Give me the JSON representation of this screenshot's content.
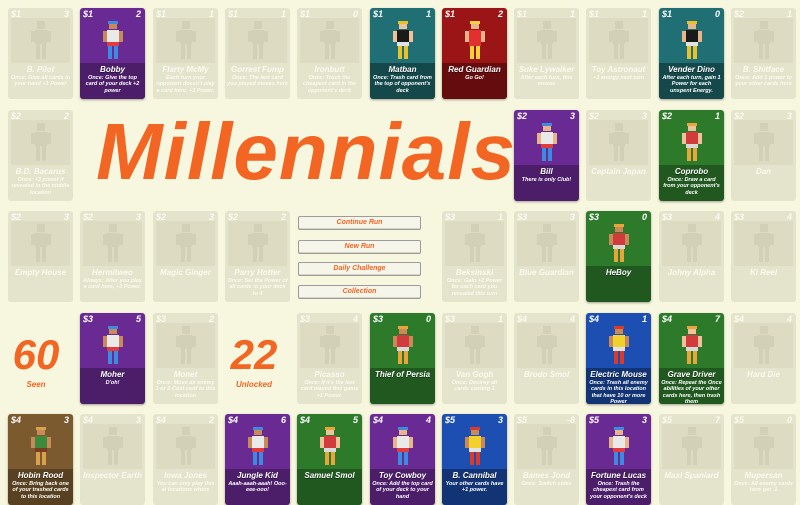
{
  "title": "Millennials",
  "menu": {
    "continue_run": "Continue Run",
    "new_run": "New Run",
    "daily_challenge": "Daily Challenge",
    "collection": "Collection"
  },
  "stats": {
    "seen_value": "60",
    "seen_label": "Seen",
    "unlocked_value": "22",
    "unlocked_label": "Unlocked"
  },
  "cards": [
    {
      "col": 0,
      "row": 0,
      "cost": "$1",
      "power": "3",
      "name": "B. Pilot",
      "desc": "Once: Give all cards in your hand +1 Power",
      "unlocked": false
    },
    {
      "col": 1,
      "row": 0,
      "cost": "$1",
      "power": "2",
      "name": "Bobby",
      "desc": "Once: Give the top card of your deck +2 power",
      "unlocked": true,
      "color": "purple"
    },
    {
      "col": 2,
      "row": 0,
      "cost": "$1",
      "power": "1",
      "name": "Flarty McMy",
      "desc": "Each turn your opponent doesn't play a card here, +3 Power.",
      "unlocked": false
    },
    {
      "col": 3,
      "row": 0,
      "cost": "$1",
      "power": "1",
      "name": "Gorrest Fump",
      "desc": "Once: The last card you played moves here",
      "unlocked": false
    },
    {
      "col": 4,
      "row": 0,
      "cost": "$1",
      "power": "0",
      "name": "Ironbutt",
      "desc": "Once: Trash the cheapest card in the opponent's deck",
      "unlocked": false
    },
    {
      "col": 5,
      "row": 0,
      "cost": "$1",
      "power": "1",
      "name": "Matban",
      "desc": "Once: Trash card from the top of opponent's deck",
      "unlocked": true,
      "color": "teal"
    },
    {
      "col": 6,
      "row": 0,
      "cost": "$1",
      "power": "2",
      "name": "Red Guardian",
      "desc": "Go Go!",
      "unlocked": true,
      "color": "red"
    },
    {
      "col": 7,
      "row": 0,
      "cost": "$1",
      "power": "1",
      "name": "Suke Lywalker",
      "desc": "After each turn, this moves",
      "unlocked": false
    },
    {
      "col": 8,
      "row": 0,
      "cost": "$1",
      "power": "1",
      "name": "Toy Astronaut",
      "desc": "+3 energy next turn",
      "unlocked": false
    },
    {
      "col": 9,
      "row": 0,
      "cost": "$1",
      "power": "0",
      "name": "Vender Dino",
      "desc": "After each turn, gain 1 Power for each unspent Energy.",
      "unlocked": true,
      "color": "teal"
    },
    {
      "col": 10,
      "row": 0,
      "cost": "$2",
      "power": "1",
      "name": "B. Shitface",
      "desc": "Once: Add 1 power to your other cards here",
      "unlocked": false
    },
    {
      "col": 0,
      "row": 1,
      "cost": "$2",
      "power": "2",
      "name": "B.D. Bacarus",
      "desc": "Once: +3 power if revealed in the middle location",
      "unlocked": false
    },
    {
      "col": 7,
      "row": 1,
      "cost": "$2",
      "power": "3",
      "name": "Bill",
      "desc": "There is only Club!",
      "unlocked": true,
      "color": "purple"
    },
    {
      "col": 8,
      "row": 1,
      "cost": "$2",
      "power": "3",
      "name": "Captain Japan",
      "desc": "",
      "unlocked": false
    },
    {
      "col": 9,
      "row": 1,
      "cost": "$2",
      "power": "1",
      "name": "Coprobo",
      "desc": "Once: Draw a card from your opponent's deck",
      "unlocked": true,
      "color": "green"
    },
    {
      "col": 10,
      "row": 1,
      "cost": "$2",
      "power": "3",
      "name": "Dan",
      "desc": "",
      "unlocked": false
    },
    {
      "col": 0,
      "row": 2,
      "cost": "$2",
      "power": "3",
      "name": "Empty House",
      "desc": "",
      "unlocked": false
    },
    {
      "col": 1,
      "row": 2,
      "cost": "$2",
      "power": "3",
      "name": "Hermitweo",
      "desc": "Always: After you play a card here, +3 Power.",
      "unlocked": false
    },
    {
      "col": 2,
      "row": 2,
      "cost": "$2",
      "power": "3",
      "name": "Magic Ginger",
      "desc": "",
      "unlocked": false
    },
    {
      "col": 3,
      "row": 2,
      "cost": "$2",
      "power": "2",
      "name": "Parry Hotter",
      "desc": "Once: Set the Power of all cards in your deck to 4",
      "unlocked": false
    },
    {
      "col": 6,
      "row": 2,
      "cost": "$3",
      "power": "1",
      "name": "Beksinski",
      "desc": "Once: Gain +2 Power for each card you revealed this turn",
      "unlocked": false
    },
    {
      "col": 7,
      "row": 2,
      "cost": "$3",
      "power": "3",
      "name": "Blue Guardian",
      "desc": "",
      "unlocked": false
    },
    {
      "col": 8,
      "row": 2,
      "cost": "$3",
      "power": "0",
      "name": "HeBoy",
      "desc": "",
      "unlocked": true,
      "color": "green"
    },
    {
      "col": 9,
      "row": 2,
      "cost": "$3",
      "power": "4",
      "name": "Johny Alpha",
      "desc": "",
      "unlocked": false
    },
    {
      "col": 10,
      "row": 2,
      "cost": "$3",
      "power": "4",
      "name": "Ki Reel",
      "desc": "",
      "unlocked": false
    },
    {
      "col": 1,
      "row": 3,
      "cost": "$3",
      "power": "5",
      "name": "Moher",
      "desc": "D'oh!",
      "unlocked": true,
      "color": "purple"
    },
    {
      "col": 2,
      "row": 3,
      "cost": "$3",
      "power": "2",
      "name": "Monet",
      "desc": "Once: Move an enemy 1 or 2-Cost card to this location",
      "unlocked": false
    },
    {
      "col": 4,
      "row": 3,
      "cost": "$3",
      "power": "4",
      "name": "Picasso",
      "desc": "Once: If it's the last card played this game +1 Power.",
      "unlocked": false
    },
    {
      "col": 5,
      "row": 3,
      "cost": "$3",
      "power": "0",
      "name": "Thief of Persia",
      "desc": "",
      "unlocked": true,
      "color": "green"
    },
    {
      "col": 6,
      "row": 3,
      "cost": "$3",
      "power": "1",
      "name": "Van Gogh",
      "desc": "Once: Destroy all cards costing 1",
      "unlocked": false
    },
    {
      "col": 7,
      "row": 3,
      "cost": "$4",
      "power": "4",
      "name": "Brodo Smol",
      "desc": "",
      "unlocked": false
    },
    {
      "col": 8,
      "row": 3,
      "cost": "$4",
      "power": "1",
      "name": "Electric Mouse",
      "desc": "Once: Trash all enemy cards in this location that have 10 or more Power",
      "unlocked": true,
      "color": "blue"
    },
    {
      "col": 9,
      "row": 3,
      "cost": "$4",
      "power": "7",
      "name": "Grave Driver",
      "desc": "Once: Repeat the Once abilities of your other cards here, then trash them",
      "unlocked": true,
      "color": "green"
    },
    {
      "col": 10,
      "row": 3,
      "cost": "$4",
      "power": "4",
      "name": "Hard Die",
      "desc": "",
      "unlocked": false
    },
    {
      "col": 0,
      "row": 4,
      "cost": "$4",
      "power": "3",
      "name": "Hobin Rood",
      "desc": "Once: Bring back one of your trashed cards to this location",
      "unlocked": true,
      "color": "brown"
    },
    {
      "col": 1,
      "row": 4,
      "cost": "$4",
      "power": "3",
      "name": "Inspector Earth",
      "desc": "",
      "unlocked": false
    },
    {
      "col": 2,
      "row": 4,
      "cost": "$4",
      "power": "2",
      "name": "Iowa Jones",
      "desc": "You can only play this at locations where",
      "unlocked": false
    },
    {
      "col": 3,
      "row": 4,
      "cost": "$4",
      "power": "6",
      "name": "Jungle Kid",
      "desc": "Aaah-aaah-aaah! Ooo-eee-ooo!",
      "unlocked": true,
      "color": "purple"
    },
    {
      "col": 4,
      "row": 4,
      "cost": "$4",
      "power": "5",
      "name": "Samuel Smol",
      "desc": "",
      "unlocked": true,
      "color": "green"
    },
    {
      "col": 5,
      "row": 4,
      "cost": "$4",
      "power": "4",
      "name": "Toy Cowboy",
      "desc": "Once: Add the top card of your deck to your hand",
      "unlocked": true,
      "color": "purple"
    },
    {
      "col": 6,
      "row": 4,
      "cost": "$5",
      "power": "3",
      "name": "B. Cannibal",
      "desc": "Your other cards have +1 power.",
      "unlocked": true,
      "color": "blue"
    },
    {
      "col": 7,
      "row": 4,
      "cost": "$5",
      "power": "-8",
      "name": "Bames Jond",
      "desc": "Once: Switch sides",
      "unlocked": false
    },
    {
      "col": 8,
      "row": 4,
      "cost": "$5",
      "power": "3",
      "name": "Fortune Lucas",
      "desc": "Once: Trash the cheapest card from your opponent's deck",
      "unlocked": true,
      "color": "purple"
    },
    {
      "col": 9,
      "row": 4,
      "cost": "$5",
      "power": "7",
      "name": "Maxi Spaniard",
      "desc": "",
      "unlocked": false
    },
    {
      "col": 10,
      "row": 4,
      "cost": "$5",
      "power": "0",
      "name": "Mupersan",
      "desc": "Once: All enemy cards here get -1",
      "unlocked": false
    }
  ]
}
